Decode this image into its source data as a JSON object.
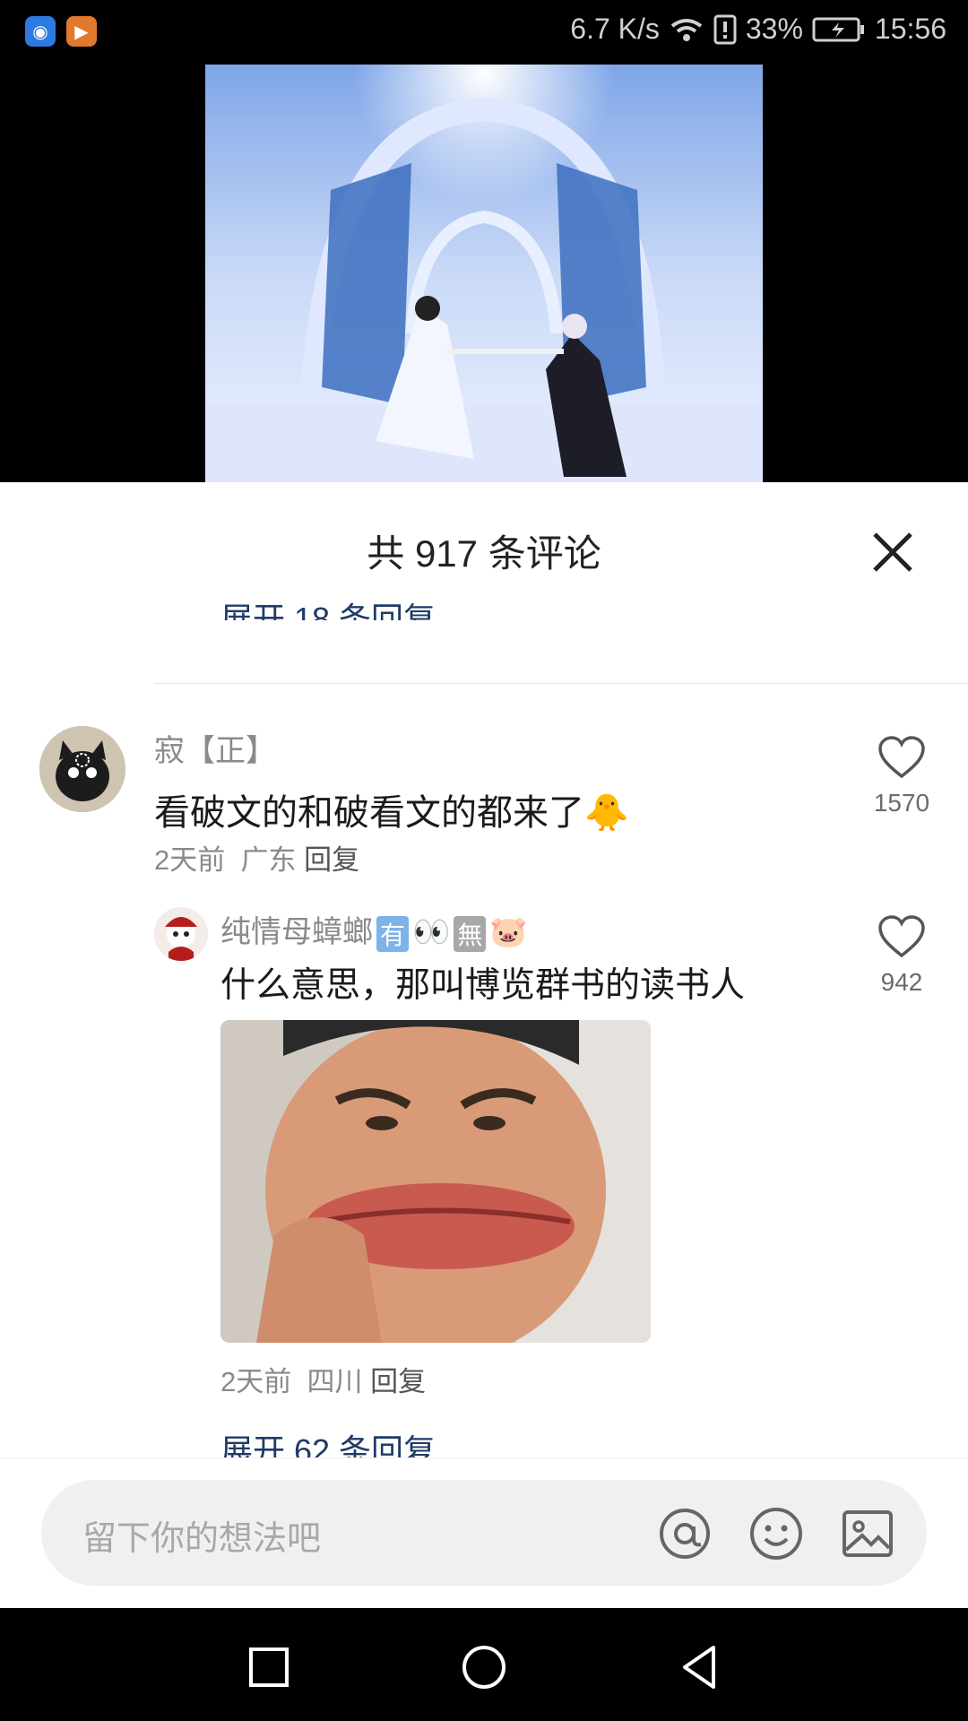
{
  "status_bar": {
    "net_speed": "6.7 K/s",
    "battery": "33%",
    "time": "15:56",
    "icons": [
      "app-badge-icon",
      "video-app-icon",
      "wifi-icon",
      "alert-icon",
      "battery-icon"
    ]
  },
  "comments_panel": {
    "title": "共 917 条评论",
    "expand_prev": "展开 18 条回复",
    "comments": [
      {
        "name": "寂【正】",
        "text": "看破文的和破看文的都来了",
        "emoji": "🐥",
        "time": "2天前",
        "location": "广东",
        "reply": "回复",
        "likes": "1570"
      },
      {
        "name": "纯情母蟑螂",
        "tags": [
          "有",
          "👀",
          "無",
          "🐷"
        ],
        "text": "什么意思，那叫博览群书的读书人",
        "time": "2天前",
        "location": "四川",
        "reply": "回复",
        "likes": "942"
      }
    ],
    "expand_next": "展开 62 条回复"
  },
  "input": {
    "placeholder": "留下你的想法吧"
  },
  "colors": {
    "link_blue": "#1f3b67",
    "text_dark": "#1a1a1a",
    "text_gray": "#8a8a8a"
  }
}
